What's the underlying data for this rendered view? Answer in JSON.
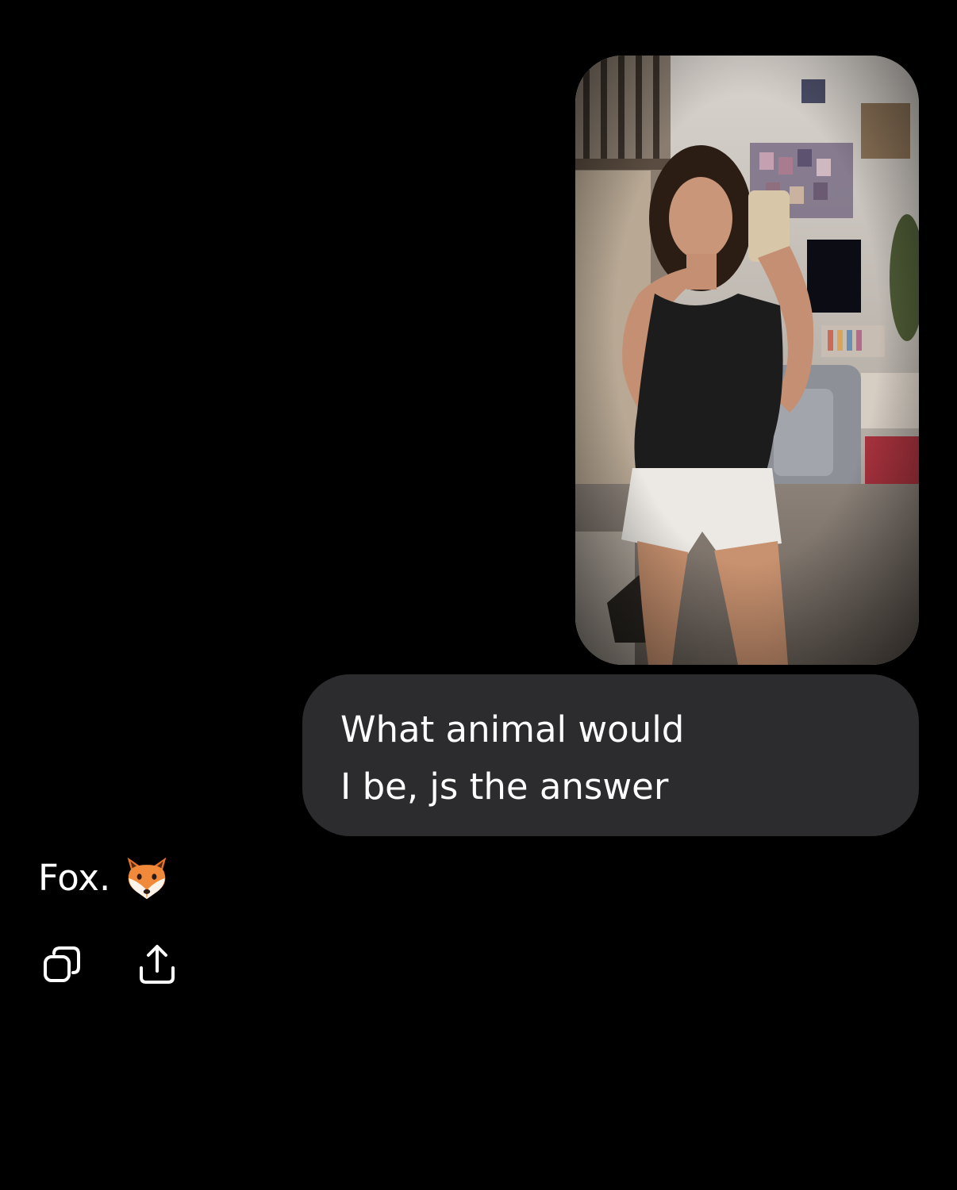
{
  "theme": {
    "background": "#000000",
    "bubble_color": "#2c2c2e",
    "text_color": "#ffffff"
  },
  "sent": {
    "photo": {
      "description_icon": "selfie-photo"
    },
    "message_lines": [
      "What animal would",
      "I be, js the answer"
    ]
  },
  "reply": {
    "text": "Fox.",
    "emoji_icon": "fox-face-icon"
  },
  "actions": {
    "copy_icon": "copy-icon",
    "share_icon": "share-icon"
  }
}
